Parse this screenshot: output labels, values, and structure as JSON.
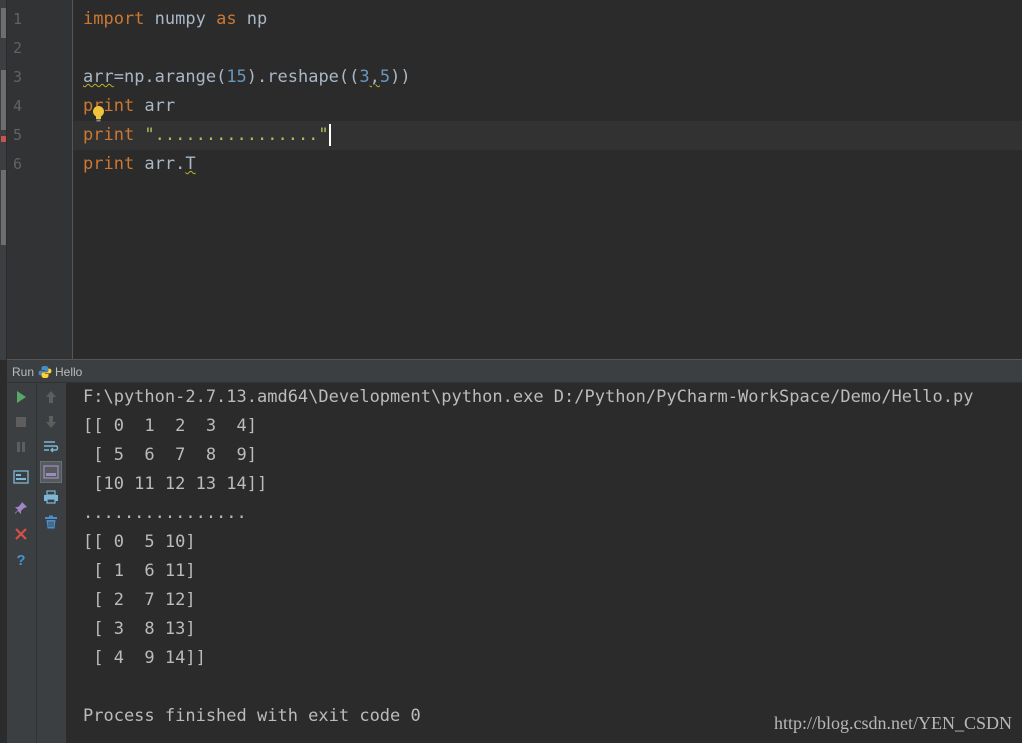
{
  "editor": {
    "lines": [
      {
        "no": "1",
        "tokens": [
          {
            "t": "import",
            "c": "kw"
          },
          {
            "t": " numpy ",
            "c": "ident"
          },
          {
            "t": "as",
            "c": "kw"
          },
          {
            "t": " np",
            "c": "ident"
          }
        ]
      },
      {
        "no": "2",
        "tokens": []
      },
      {
        "no": "3",
        "tokens": [
          {
            "t": "arr",
            "c": "ident squiggle"
          },
          {
            "t": "=np.arange(",
            "c": "ident"
          },
          {
            "t": "15",
            "c": "num"
          },
          {
            "t": ").reshape((",
            "c": "ident"
          },
          {
            "t": "3",
            "c": "num"
          },
          {
            "t": ",",
            "c": "ident squiggle"
          },
          {
            "t": "5",
            "c": "num"
          },
          {
            "t": "))",
            "c": "ident"
          }
        ]
      },
      {
        "no": "4",
        "tokens": [
          {
            "t": "print",
            "c": "kw"
          },
          {
            "t": " arr",
            "c": "ident"
          }
        ]
      },
      {
        "no": "5",
        "tokens": [
          {
            "t": "print",
            "c": "kw"
          },
          {
            "t": " \"................\"",
            "c": "str"
          }
        ]
      },
      {
        "no": "6",
        "tokens": [
          {
            "t": "print",
            "c": "kw"
          },
          {
            "t": " arr.",
            "c": "ident"
          },
          {
            "t": "T",
            "c": "ident squiggle"
          }
        ]
      }
    ]
  },
  "run_panel": {
    "tab_label": "Run",
    "config_name": "Hello",
    "output": [
      "F:\\python-2.7.13.amd64\\Development\\python.exe D:/Python/PyCharm-WorkSpace/Demo/Hello.py",
      "[[ 0  1  2  3  4]",
      " [ 5  6  7  8  9]",
      " [10 11 12 13 14]]",
      "................",
      "[[ 0  5 10]",
      " [ 1  6 11]",
      " [ 2  7 12]",
      " [ 3  8 13]",
      " [ 4  9 14]]",
      "",
      "Process finished with exit code 0"
    ]
  },
  "watermark": "http://blog.csdn.net/YEN_CSDN",
  "icons": {
    "run": "run-icon",
    "stop": "stop-icon",
    "pause": "pause-icon",
    "up": "arrow-up-icon",
    "down": "arrow-down-icon",
    "close": "close-icon",
    "help": "help-icon"
  },
  "colors": {
    "keyword": "#cc7832",
    "number": "#6897bb",
    "string": "#a5c25c",
    "text": "#a9b7c6",
    "background": "#2b2b2b"
  }
}
